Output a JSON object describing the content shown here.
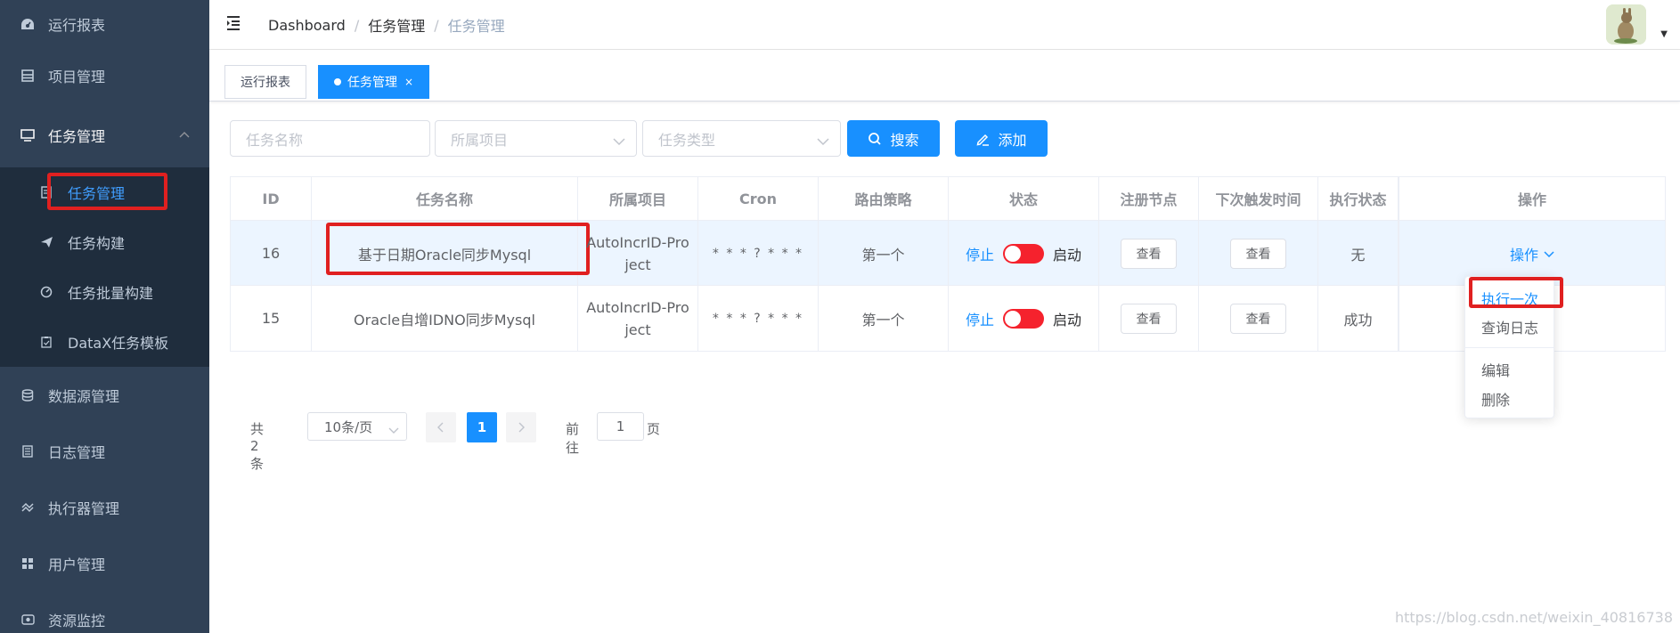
{
  "sidebar": {
    "items": [
      {
        "label": "运行报表",
        "icon": "dashboard-icon"
      },
      {
        "label": "项目管理",
        "icon": "project-icon"
      },
      {
        "label": "任务管理",
        "icon": "monitor-icon"
      },
      {
        "label": "数据源管理",
        "icon": "database-icon"
      },
      {
        "label": "日志管理",
        "icon": "log-icon"
      },
      {
        "label": "执行器管理",
        "icon": "executor-icon"
      },
      {
        "label": "用户管理",
        "icon": "user-grid-icon"
      },
      {
        "label": "资源监控",
        "icon": "resource-icon"
      }
    ],
    "submenu": [
      {
        "label": "任务管理",
        "icon": "task-list-icon"
      },
      {
        "label": "任务构建",
        "icon": "send-icon"
      },
      {
        "label": "任务批量构建",
        "icon": "batch-icon"
      },
      {
        "label": "DataX任务模板",
        "icon": "template-icon"
      }
    ]
  },
  "navbar": {
    "breadcrumb": [
      "Dashboard",
      "任务管理",
      "任务管理"
    ],
    "separator": "/"
  },
  "tags": [
    {
      "label": "运行报表"
    },
    {
      "label": "任务管理",
      "close": "×"
    }
  ],
  "filters": {
    "task_name_placeholder": "任务名称",
    "project_placeholder": "所属项目",
    "task_type_placeholder": "任务类型",
    "search_label": "搜索",
    "add_label": "添加"
  },
  "table": {
    "headers": [
      "ID",
      "任务名称",
      "所属项目",
      "Cron",
      "路由策略",
      "状态",
      "注册节点",
      "下次触发时间",
      "执行状态",
      "操作"
    ],
    "rows": [
      {
        "id": "16",
        "name": "基于日期Oracle同步Mysql",
        "project": "AutoIncrID-Project",
        "cron": "* * * ? * * *",
        "route": "第一个",
        "stop": "停止",
        "start": "启动",
        "node_btn": "查看",
        "next_btn": "查看",
        "exec_status": "无",
        "op": "操作"
      },
      {
        "id": "15",
        "name": "Oracle自增IDNO同步Mysql",
        "project": "AutoIncrID-Project",
        "cron": "* * * ? * * *",
        "route": "第一个",
        "stop": "停止",
        "start": "启动",
        "node_btn": "查看",
        "next_btn": "查看",
        "exec_status": "成功"
      }
    ]
  },
  "dropdown": {
    "items": [
      "执行一次",
      "查询日志",
      "编辑",
      "删除"
    ]
  },
  "pagination": {
    "total": "共 2 条",
    "page_size": "10条/页",
    "current_page": "1",
    "goto_label": "前往",
    "goto_value": "1",
    "goto_suffix": "页"
  },
  "watermark": "https://blog.csdn.net/weixin_40816738",
  "colors": {
    "sidebar_bg": "#304156",
    "submenu_bg": "#1f2d3d",
    "primary": "#1890ff",
    "switch_off": "#f5222d",
    "highlight_box": "#e02020"
  }
}
